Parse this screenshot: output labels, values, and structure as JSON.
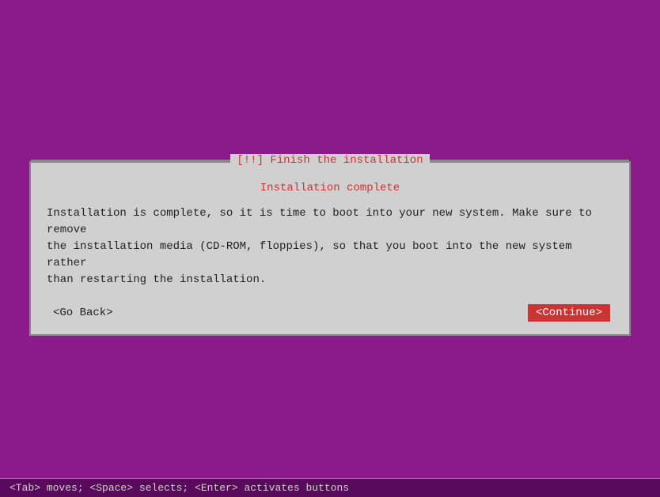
{
  "dialog": {
    "title": "[!!] Finish the installation",
    "subtitle": "Installation complete",
    "message": "Installation is complete, so it is time to boot into your new system. Make sure to remove\nthe installation media (CD-ROM, floppies), so that you boot into the new system rather\nthan restarting the installation.",
    "go_back_label": "<Go Back>",
    "continue_label": "<Continue>"
  },
  "status_bar": {
    "text": "<Tab> moves; <Space> selects; <Enter> activates buttons"
  },
  "colors": {
    "background": "#8b1a8b",
    "dialog_bg": "#d0d0d0",
    "title_color": "#cc3333",
    "continue_bg": "#cc3333"
  }
}
